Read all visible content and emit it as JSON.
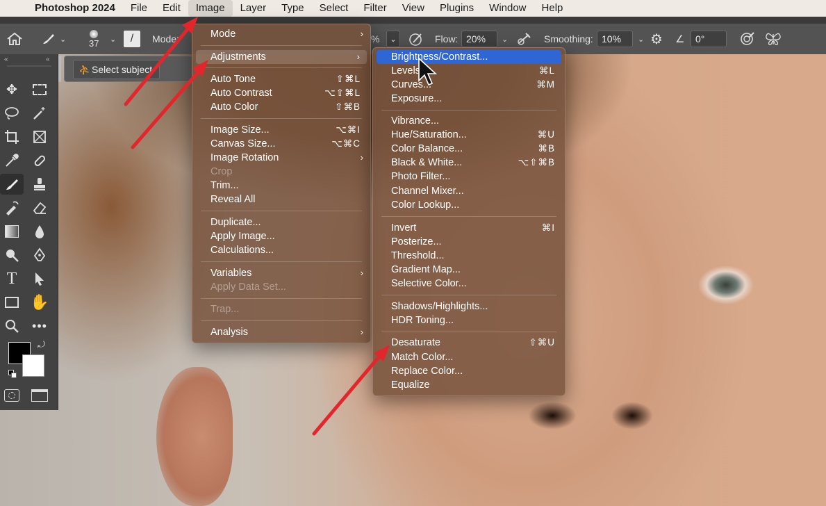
{
  "menubar": {
    "apple": "",
    "app": "Photoshop 2024",
    "items": [
      "File",
      "Edit",
      "Image",
      "Layer",
      "Type",
      "Select",
      "Filter",
      "View",
      "Plugins",
      "Window",
      "Help"
    ]
  },
  "options": {
    "brush_size": "37",
    "mode_label": "Mode:",
    "opacity_suffix": "%",
    "flow_label": "Flow:",
    "flow_value": "20%",
    "smoothing_label": "Smoothing:",
    "smoothing_value": "10%",
    "angle_value": "0°"
  },
  "context": {
    "select_subject": "Select subject"
  },
  "image_menu": {
    "mode": "Mode",
    "adjustments": "Adjustments",
    "auto_tone": "Auto Tone",
    "auto_tone_sc": "⇧⌘L",
    "auto_contrast": "Auto Contrast",
    "auto_contrast_sc": "⌥⇧⌘L",
    "auto_color": "Auto Color",
    "auto_color_sc": "⇧⌘B",
    "image_size": "Image Size...",
    "image_size_sc": "⌥⌘I",
    "canvas_size": "Canvas Size...",
    "canvas_size_sc": "⌥⌘C",
    "image_rotation": "Image Rotation",
    "crop": "Crop",
    "trim": "Trim...",
    "reveal_all": "Reveal All",
    "duplicate": "Duplicate...",
    "apply_image": "Apply Image...",
    "calculations": "Calculations...",
    "variables": "Variables",
    "apply_data_set": "Apply Data Set...",
    "trap": "Trap...",
    "analysis": "Analysis"
  },
  "adjust_menu": {
    "brightness_contrast": "Brightness/Contrast...",
    "levels": "Levels...",
    "levels_sc": "⌘L",
    "curves": "Curves...",
    "curves_sc": "⌘M",
    "exposure": "Exposure...",
    "vibrance": "Vibrance...",
    "hue_saturation": "Hue/Saturation...",
    "hue_saturation_sc": "⌘U",
    "color_balance": "Color Balance...",
    "color_balance_sc": "⌘B",
    "black_white": "Black & White...",
    "black_white_sc": "⌥⇧⌘B",
    "photo_filter": "Photo Filter...",
    "channel_mixer": "Channel Mixer...",
    "color_lookup": "Color Lookup...",
    "invert": "Invert",
    "invert_sc": "⌘I",
    "posterize": "Posterize...",
    "threshold": "Threshold...",
    "gradient_map": "Gradient Map...",
    "selective_color": "Selective Color...",
    "shadows_highlights": "Shadows/Highlights...",
    "hdr_toning": "HDR Toning...",
    "desaturate": "Desaturate",
    "desaturate_sc": "⇧⌘U",
    "match_color": "Match Color...",
    "replace_color": "Replace Color...",
    "equalize": "Equalize"
  },
  "colors": {
    "highlight": "#2f66d6",
    "arrow": "#e3262b",
    "menu_bg": "rgba(120,84,62,0.86)"
  }
}
